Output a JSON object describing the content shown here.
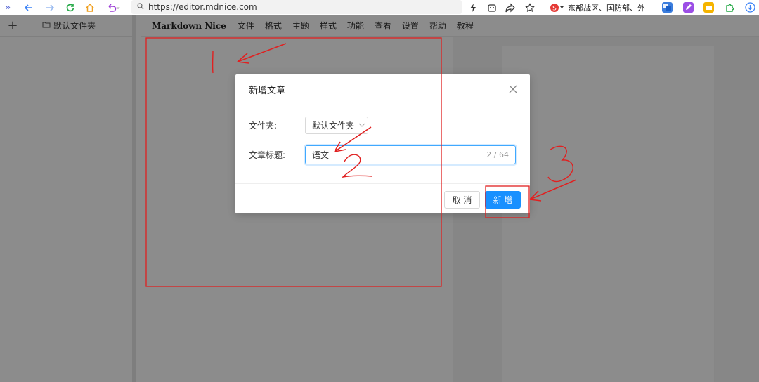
{
  "browser": {
    "url": "https://editor.mdnice.com",
    "news_text": "东部战区、国防部、外"
  },
  "folders": {
    "add_label": "+",
    "current_folder": "默认文件夹"
  },
  "menu": {
    "brand": "Markdown Nice",
    "items": [
      "文件",
      "格式",
      "主题",
      "样式",
      "功能",
      "查看",
      "设置",
      "帮助",
      "教程"
    ]
  },
  "modal": {
    "title": "新增文章",
    "folder_label": "文件夹:",
    "folder_value": "默认文件夹",
    "title_label": "文章标题:",
    "title_value": "语文",
    "char_count": "2 / 64",
    "cancel_label": "取 消",
    "ok_label": "新 增"
  },
  "annotations": {
    "labels": [
      "1",
      "2",
      "3"
    ],
    "color": "#e02020"
  },
  "colors": {
    "accent": "#1890ff",
    "overlay": "#000000",
    "annotation": "#e02020"
  }
}
